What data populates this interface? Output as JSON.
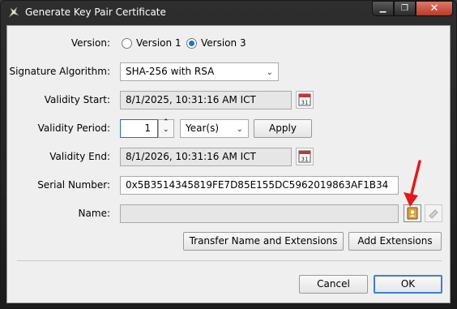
{
  "window": {
    "title": "Generate Key Pair Certificate",
    "controls": {
      "minimize": "▁",
      "maximize": "❐",
      "close": "✕"
    }
  },
  "form": {
    "version": {
      "label": "Version:",
      "options": [
        "Version 1",
        "Version 3"
      ],
      "selected": "Version 3"
    },
    "signature_algorithm": {
      "label": "Signature Algorithm:",
      "value": "SHA-256 with RSA"
    },
    "validity_start": {
      "label": "Validity Start:",
      "value": "8/1/2025, 10:31:16 AM ICT"
    },
    "validity_period": {
      "label": "Validity Period:",
      "value": "1",
      "unit": "Year(s)",
      "apply_label": "Apply"
    },
    "validity_end": {
      "label": "Validity End:",
      "value": "8/1/2026, 10:31:16 AM ICT"
    },
    "serial_number": {
      "label": "Serial Number:",
      "value": "0x5B3514345819FE7D85E155DC5962019863AF1B34"
    },
    "name": {
      "label": "Name:",
      "value": ""
    }
  },
  "buttons": {
    "transfer": "Transfer Name and Extensions",
    "add_extensions": "Add Extensions",
    "cancel": "Cancel",
    "ok": "OK"
  },
  "calendar_day": "31",
  "colors": {
    "accent": "#1d6fd6",
    "arrow": "#e01a1a"
  }
}
